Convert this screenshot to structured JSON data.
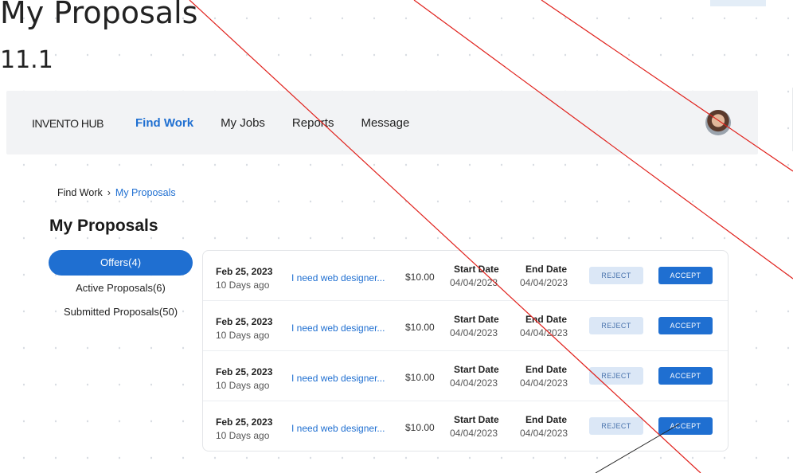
{
  "page": {
    "title": "My Proposals",
    "subtitle": "11.1"
  },
  "navbar": {
    "brand": "INVENTO HUB",
    "items": [
      {
        "label": "Find Work",
        "active": true
      },
      {
        "label": "My Jobs"
      },
      {
        "label": "Reports"
      },
      {
        "label": "Message"
      }
    ],
    "avatar_icon": "user-avatar"
  },
  "breadcrumb": {
    "parent": "Find Work",
    "separator": "›",
    "current": "My Proposals"
  },
  "section_title": "My Proposals",
  "side_menu": [
    {
      "label": "Offers(4)",
      "active": true
    },
    {
      "label": "Active Proposals(6)"
    },
    {
      "label": "Submitted Proposals(50)"
    }
  ],
  "proposals": [
    {
      "date": "Feb 25, 2023",
      "ago": "10 Days ago",
      "title": "I need web designer...",
      "price": "$10.00",
      "start_label": "Start Date",
      "start_date": "04/04/2023",
      "end_label": "End Date",
      "end_date": "04/04/2023",
      "reject": "REJECT",
      "accept": "ACCEPT"
    },
    {
      "date": "Feb 25, 2023",
      "ago": "10 Days ago",
      "title": "I need web designer...",
      "price": "$10.00",
      "start_label": "Start Date",
      "start_date": "04/04/2023",
      "end_label": "End Date",
      "end_date": "04/04/2023",
      "reject": "REJECT",
      "accept": "ACCEPT"
    },
    {
      "date": "Feb 25, 2023",
      "ago": "10 Days ago",
      "title": "I need web designer...",
      "price": "$10.00",
      "start_label": "Start Date",
      "start_date": "04/04/2023",
      "end_label": "End Date",
      "end_date": "04/04/2023",
      "reject": "REJECT",
      "accept": "ACCEPT"
    },
    {
      "date": "Feb 25, 2023",
      "ago": "10 Days ago",
      "title": "I need web designer...",
      "price": "$10.00",
      "start_label": "Start Date",
      "start_date": "04/04/2023",
      "end_label": "End Date",
      "end_date": "04/04/2023",
      "reject": "REJECT",
      "accept": "ACCEPT"
    }
  ],
  "colors": {
    "accent": "#1f6fd1",
    "annotation_line": "#e0201b",
    "nav_bg": "#f2f3f5",
    "reject_bg": "#dbe7f6"
  }
}
